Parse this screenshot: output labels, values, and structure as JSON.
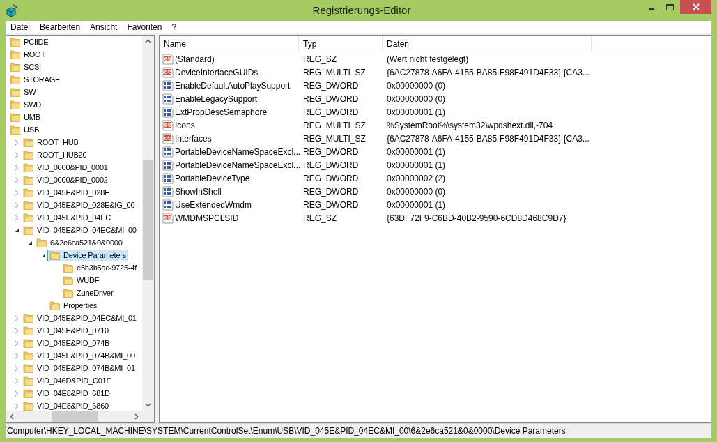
{
  "window": {
    "title": "Registrierungs-Editor"
  },
  "menu": [
    "Datei",
    "Bearbeiten",
    "Ansicht",
    "Favoriten",
    "?"
  ],
  "tree": [
    {
      "label": "PCIIDE",
      "selected": false
    },
    {
      "label": "ROOT",
      "selected": false
    },
    {
      "label": "SCSI",
      "selected": false
    },
    {
      "label": "STORAGE",
      "selected": false
    },
    {
      "label": "SW",
      "selected": false
    },
    {
      "label": "SWD",
      "selected": false
    },
    {
      "label": "UMB",
      "selected": false
    },
    {
      "label": "USB",
      "selected": false,
      "children": [
        {
          "label": "ROOT_HUB",
          "expanded": false,
          "selected": false
        },
        {
          "label": "ROOT_HUB20",
          "expanded": false,
          "selected": false
        },
        {
          "label": "VID_0000&PID_0001",
          "expanded": false,
          "selected": false
        },
        {
          "label": "VID_0000&PID_0002",
          "expanded": false,
          "selected": false
        },
        {
          "label": "VID_045E&PID_028E",
          "expanded": false,
          "selected": false
        },
        {
          "label": "VID_045E&PID_028E&IG_00",
          "expanded": false,
          "selected": false
        },
        {
          "label": "VID_045E&PID_04EC",
          "expanded": false,
          "selected": false
        },
        {
          "label": "VID_045E&PID_04EC&MI_00",
          "expanded": true,
          "selected": false,
          "children": [
            {
              "label": "6&2e6ca521&0&0000",
              "expanded": true,
              "selected": false,
              "children": [
                {
                  "label": "Device Parameters",
                  "expanded": true,
                  "selected": true,
                  "children": [
                    {
                      "label": "e5b3b5ac-9725-4f",
                      "selected": false
                    },
                    {
                      "label": "WUDF",
                      "selected": false
                    },
                    {
                      "label": "ZuneDriver",
                      "selected": false
                    }
                  ]
                },
                {
                  "label": "Properties",
                  "selected": false
                }
              ]
            }
          ]
        },
        {
          "label": "VID_045E&PID_04EC&MI_01",
          "expanded": false,
          "selected": false
        },
        {
          "label": "VID_045E&PID_0710",
          "expanded": false,
          "selected": false
        },
        {
          "label": "VID_045E&PID_074B",
          "expanded": false,
          "selected": false
        },
        {
          "label": "VID_045E&PID_074B&MI_00",
          "expanded": false,
          "selected": false
        },
        {
          "label": "VID_045E&PID_074B&MI_01",
          "expanded": false,
          "selected": false
        },
        {
          "label": "VID_046D&PID_C01E",
          "expanded": false,
          "selected": false
        },
        {
          "label": "VID_04E8&PID_681D",
          "expanded": false,
          "selected": false
        },
        {
          "label": "VID_04E8&PID_6860",
          "expanded": false,
          "selected": false
        }
      ]
    }
  ],
  "table": {
    "columns": [
      "Name",
      "Typ",
      "Daten"
    ],
    "rows": [
      {
        "kind": "string",
        "name": "(Standard)",
        "type": "REG_SZ",
        "data": "(Wert nicht festgelegt)"
      },
      {
        "kind": "string",
        "name": "DeviceInterfaceGUIDs",
        "type": "REG_MULTI_SZ",
        "data": "{6AC27878-A6FA-4155-BA85-F98F491D4F33} {CA3..."
      },
      {
        "kind": "number",
        "name": "EnableDefaultAutoPlaySupport",
        "type": "REG_DWORD",
        "data": "0x00000000 (0)"
      },
      {
        "kind": "number",
        "name": "EnableLegacySupport",
        "type": "REG_DWORD",
        "data": "0x00000000 (0)"
      },
      {
        "kind": "number",
        "name": "ExtPropDescSemaphore",
        "type": "REG_DWORD",
        "data": "0x00000001 (1)"
      },
      {
        "kind": "string",
        "name": "Icons",
        "type": "REG_MULTI_SZ",
        "data": "%SystemRoot%\\system32\\wpdshext.dll,-704"
      },
      {
        "kind": "string",
        "name": "Interfaces",
        "type": "REG_MULTI_SZ",
        "data": "{6AC27878-A6FA-4155-BA85-F98F491D4F33} {CA3..."
      },
      {
        "kind": "number",
        "name": "PortableDeviceNameSpaceExcl...",
        "type": "REG_DWORD",
        "data": "0x00000001 (1)"
      },
      {
        "kind": "number",
        "name": "PortableDeviceNameSpaceExcl...",
        "type": "REG_DWORD",
        "data": "0x00000001 (1)"
      },
      {
        "kind": "number",
        "name": "PortableDeviceType",
        "type": "REG_DWORD",
        "data": "0x00000002 (2)"
      },
      {
        "kind": "number",
        "name": "ShowInShell",
        "type": "REG_DWORD",
        "data": "0x00000000 (0)"
      },
      {
        "kind": "number",
        "name": "UseExtendedWmdm",
        "type": "REG_DWORD",
        "data": "0x00000001 (1)"
      },
      {
        "kind": "string",
        "name": "WMDMSPCLSID",
        "type": "REG_SZ",
        "data": "{63DF72F9-C6BD-40B2-9590-6CD8D468C9D7}"
      }
    ]
  },
  "status_bar": "Computer\\HKEY_LOCAL_MACHINE\\SYSTEM\\CurrentControlSet\\Enum\\USB\\VID_045E&PID_04EC&MI_00\\6&2e6ca521&0&0000\\Device Parameters"
}
